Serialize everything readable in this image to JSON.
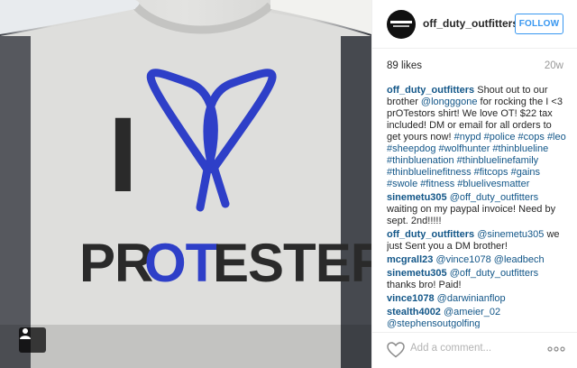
{
  "photo": {
    "shirt_word": "PROTESTERS",
    "shirt_letter": "I",
    "shirt_colors": {
      "ink": "#2a2a2a",
      "blue": "#2e3fc8",
      "fabric": "#dededc"
    }
  },
  "post": {
    "username": "off_duty_outfitters",
    "follow_label": "FOLLOW",
    "likes": "89 likes",
    "age": "20w",
    "add_comment_placeholder": "Add a comment...",
    "caption": {
      "user": "off_duty_outfitters",
      "text1": " Shout out to our brother ",
      "mention": "@longggone",
      "text2": " for rocking the I <3 prOTestors shirt! We love OT! $22 tax included! DM or email for all orders to get yours now! ",
      "hashtags": "#nypd #police #cops #leo #sheepdog #wolfhunter #thinblueline #thinbluenation #thinbluelinefamily #thinbluelinefitness #fitcops #gains #swole #fitness #bluelivesmatter"
    },
    "comments": [
      {
        "user": "sinemetu305",
        "mention": "@off_duty_outfitters",
        "text": " waiting on my paypal invoice! Need by sept. 2nd!!!!!"
      },
      {
        "user": "off_duty_outfitters",
        "mention": "@sinemetu305",
        "text": " we just Sent you a DM brother!"
      },
      {
        "user": "mcgrall23",
        "mention": "@vince1078 @leadbech",
        "text": ""
      },
      {
        "user": "sinemetu305",
        "mention": "@off_duty_outfitters",
        "text": " thanks bro! Paid!"
      },
      {
        "user": "vince1078",
        "mention": "@darwinianflop",
        "text": ""
      },
      {
        "user": "stealth4002",
        "mention": "@ameier_02 @stephensoutgolfing",
        "text": ""
      }
    ]
  },
  "icons": {
    "heart": "heart-icon",
    "more": "more-icon",
    "user": "user-icon"
  },
  "colors": {
    "link": "#125688",
    "follow": "#3897f0",
    "muted": "#999999"
  }
}
